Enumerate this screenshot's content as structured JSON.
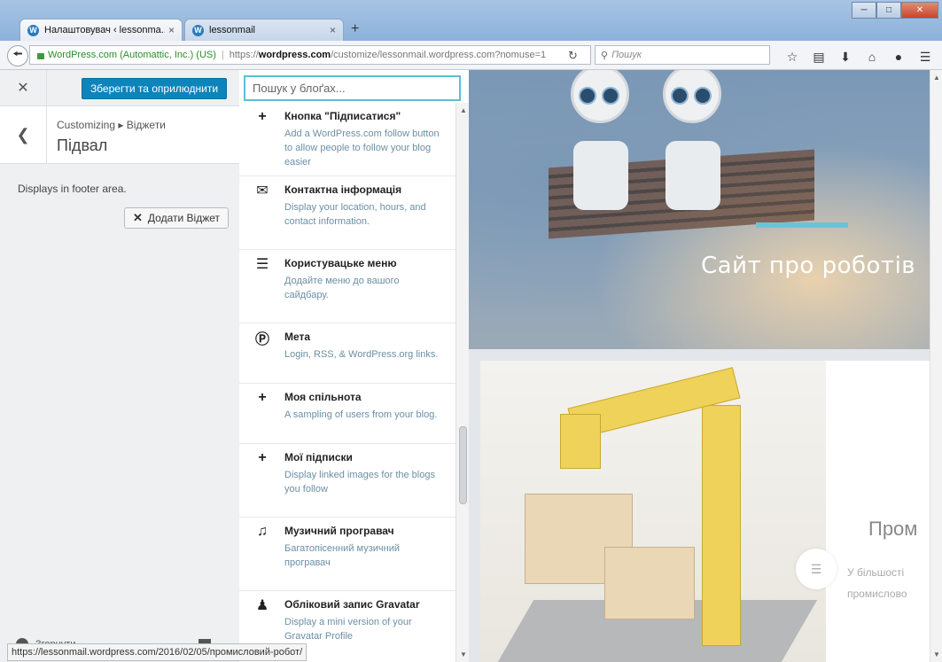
{
  "browser": {
    "tabs": [
      {
        "title": "Налаштовувач ‹ lessonma...",
        "close": "×"
      },
      {
        "title": "lessonmail",
        "close": "×"
      }
    ],
    "new_tab": "+",
    "url": {
      "identity": "WordPress.com (Automattic, Inc.) (US)",
      "scheme": "https://",
      "host": "wordpress.com",
      "path": "/customize/lessonmail.wordpress.com?nomuse=1"
    },
    "search_placeholder": "Пошук",
    "status_url": "https://lessonmail.wordpress.com/2016/02/05/промисловий-робот/"
  },
  "customizer": {
    "save_label": "Зберегти та оприлюднити",
    "breadcrumb": "Customizing ▸ Віджети",
    "section_title": "Підвал",
    "description": "Displays in footer area.",
    "add_widget_label": "Додати Віджет",
    "footer_label": "Згорнути"
  },
  "widgets": {
    "search_placeholder": "Пошук у блоґах...",
    "items": [
      {
        "icon": "plus-icon",
        "title": "Кнопка \"Підписатися\"",
        "desc": "Add a WordPress.com follow button to allow people to follow your blog easier"
      },
      {
        "icon": "envelope-icon",
        "title": "Контактна інформація",
        "desc": "Display your location, hours, and contact information."
      },
      {
        "icon": "menu-icon",
        "title": "Користувацьке меню",
        "desc": "Додайте меню до вашого сайдбару."
      },
      {
        "icon": "wordpress-icon",
        "title": "Мета",
        "desc": "Login, RSS, & WordPress.org links."
      },
      {
        "icon": "plus-icon",
        "title": "Моя спільнота",
        "desc": "A sampling of users from your blog."
      },
      {
        "icon": "plus-icon",
        "title": "Мої підписки",
        "desc": "Display linked images for the blogs you follow"
      },
      {
        "icon": "music-note-icon",
        "title": "Музичний програвач",
        "desc": "Багатопісенний музичний програвач"
      },
      {
        "icon": "person-icon",
        "title": "Обліковий запис Gravatar",
        "desc": "Display a mini version of your Gravatar Profile"
      }
    ]
  },
  "preview": {
    "site_title": "Сайт про роботів",
    "post_title": "Пром",
    "post_excerpt_1": "У більшості",
    "post_excerpt_2": "промислово"
  },
  "colors": {
    "accent": "#0d84ba",
    "search_focus": "#5bc0d8",
    "desc_text": "#6b8fa5"
  }
}
